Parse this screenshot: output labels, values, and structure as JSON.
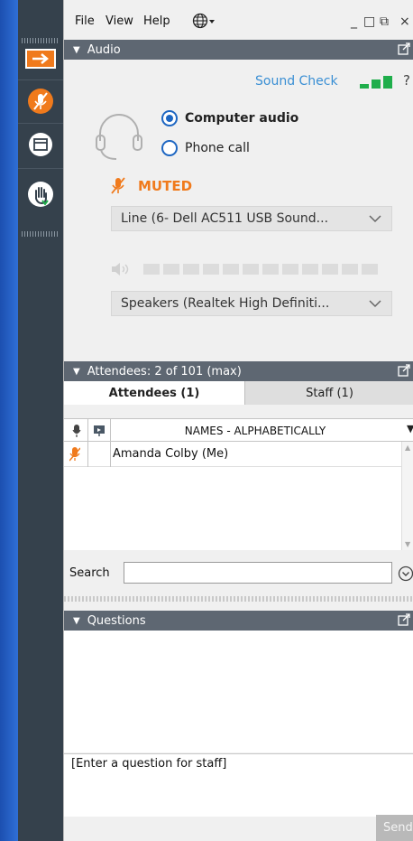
{
  "menu": {
    "file": "File",
    "view": "View",
    "help": "Help",
    "language_icon": "globe-icon"
  },
  "window_controls": {
    "minimize": "_",
    "maximize": "□",
    "restore": "⧉",
    "close": "×"
  },
  "audio": {
    "title": "Audio",
    "sound_check": "Sound Check",
    "help": "?",
    "computer_audio": "Computer audio",
    "phone_call": "Phone call",
    "selected_mode": "Computer audio",
    "status": "MUTED",
    "microphone_device": "Line (6- Dell AC511 USB Sound...",
    "speaker_device": "Speakers (Realtek High Definiti...",
    "mic_level_fraction": 0,
    "signal_bars_active": 3
  },
  "attendees": {
    "title": "Attendees: 2 of 101 (max)",
    "tab_attendees": "Attendees (1)",
    "tab_staff": "Staff (1)",
    "column_names": "NAMES - ALPHABETICALLY",
    "rows": [
      {
        "name": "Amanda Colby (Me)",
        "muted": true
      }
    ],
    "search_label": "Search",
    "search_value": ""
  },
  "questions": {
    "title": "Questions",
    "placeholder": "[Enter a question for staff]",
    "send": "Send"
  },
  "colors": {
    "toolbar": "#35414c",
    "header": "#5e6772",
    "accent_orange": "#f07a1c",
    "link_blue": "#3a8fd4",
    "signal_green": "#1fae4b"
  }
}
